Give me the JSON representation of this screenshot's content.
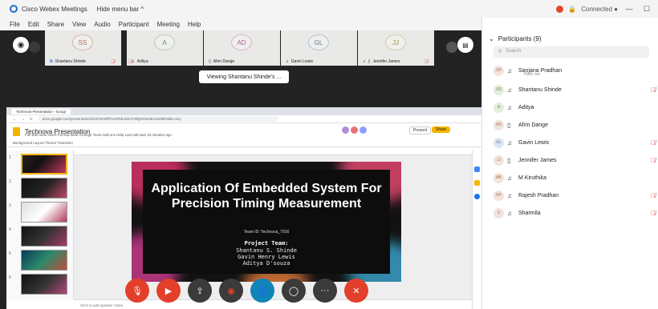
{
  "titlebar": {
    "app_name": "Cisco Webex Meetings",
    "hide_menu": "Hide menu bar ^",
    "status": "Connected ●",
    "minimize": "—",
    "maximize": "☐"
  },
  "menubar": {
    "items": [
      "File",
      "Edit",
      "Share",
      "View",
      "Audio",
      "Participant",
      "Meeting",
      "Help"
    ]
  },
  "thumbnails": [
    {
      "initials": "SS",
      "name": "Shantanu Shinde",
      "muted": true
    },
    {
      "initials": "A",
      "name": "Aditya",
      "muted": false
    },
    {
      "initials": "AD",
      "name": "Afrin Dange",
      "muted": false
    },
    {
      "initials": "GL",
      "name": "Gavin Lewis",
      "muted": false
    },
    {
      "initials": "JJ",
      "name": "Jennifer James",
      "muted": true
    }
  ],
  "viewing_banner": "Viewing Shantanu Shinde's ...",
  "browser": {
    "tab_title": "Technova Presentation - Googl",
    "url": "docs.google.com/presentation/d/1lC0mRfF0xcRbfL0dc1Y9lQ0m0x0Ex1/edit#slide=id.p",
    "doc_title": "Technova Presentation",
    "doc_menu": "File  Edit  View  Insert  Format  Slide  Arrange  Tools  Add-ons  Help  Last edit was 33 minutes ago",
    "toolbar": "Background   Layout   Theme   Transition",
    "present_label": "Present",
    "share_label": "Share",
    "notes_placeholder": "Click to add speaker notes"
  },
  "slide": {
    "title": "Application Of Embedded System For Precision Timing Measurement",
    "subtitle": "Team ID: Technova_7916",
    "team_heading": "Project Team:",
    "team": [
      "Shantanu S. Shinde",
      "Gavin Henry Lewis",
      "Aditya D'souza"
    ]
  },
  "participants": {
    "header": "Participants (9)",
    "search_placeholder": "Search",
    "list": [
      {
        "initials": "SP",
        "name": "Sanjana Pradhan",
        "sub": "Host, me",
        "muted": false
      },
      {
        "initials": "SS",
        "name": "Shantanu Shinde",
        "sub": "",
        "muted": true
      },
      {
        "initials": "A",
        "name": "Aditya",
        "sub": "",
        "muted": false
      },
      {
        "initials": "AD",
        "name": "Afrin Dange",
        "sub": "",
        "muted": false
      },
      {
        "initials": "GL",
        "name": "Gavin Lewis",
        "sub": "",
        "muted": true
      },
      {
        "initials": "JJ",
        "name": "Jennifer James",
        "sub": "",
        "muted": true
      },
      {
        "initials": "MK",
        "name": "M Kiruthika",
        "sub": "",
        "muted": false
      },
      {
        "initials": "RP",
        "name": "Rajesh Pradhan",
        "sub": "",
        "muted": true
      },
      {
        "initials": "S",
        "name": "Sharmila",
        "sub": "",
        "muted": true
      }
    ]
  },
  "icons": {
    "mic_muted": "mic-off-icon",
    "video_muted": "video-off-icon",
    "share": "share-icon",
    "record": "record-icon",
    "participants": "participants-icon",
    "chat": "chat-icon",
    "more": "more-icon",
    "leave": "close-icon"
  },
  "colors": {
    "control_red": "#e33f2b",
    "control_blue": "#0f84b8",
    "meeting_bg": "#232323",
    "slides_yellow": "#f4b400"
  }
}
